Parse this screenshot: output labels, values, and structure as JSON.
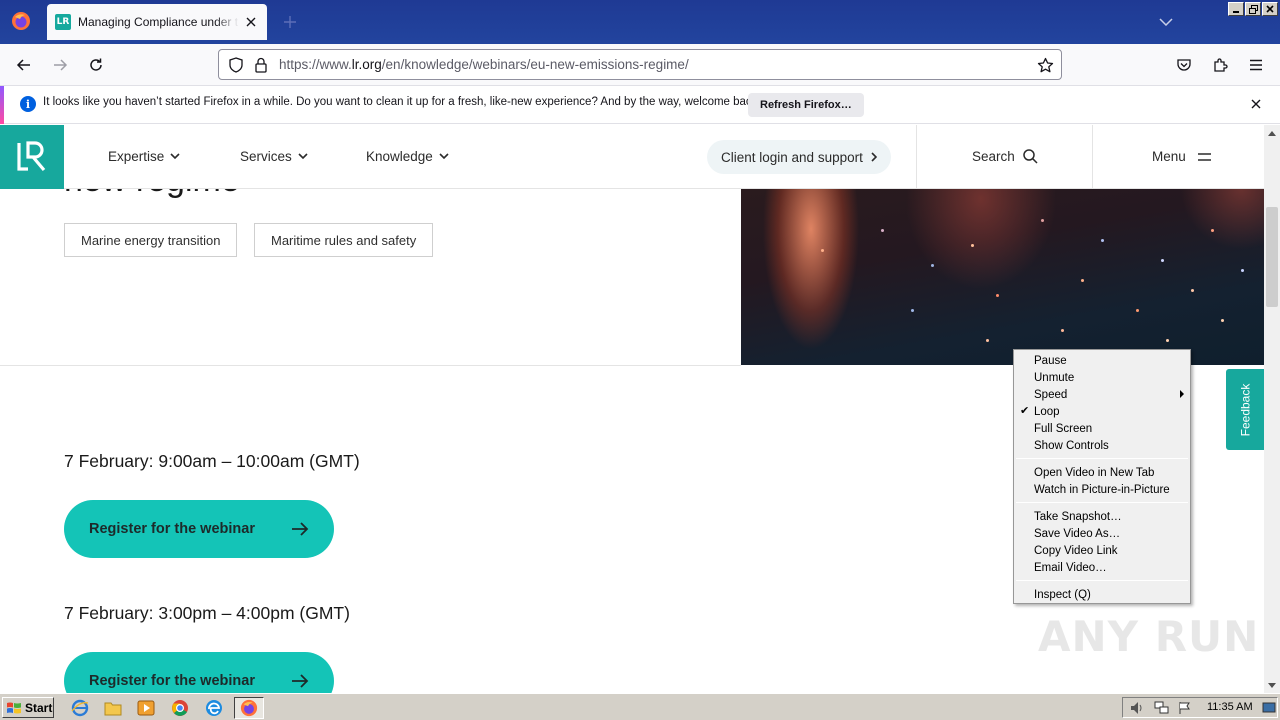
{
  "browser": {
    "tab_title": "Managing Compliance under the EU",
    "tab_favicon_text": "LR",
    "url_prefix": "https://www.",
    "url_domain": "lr.org",
    "url_path": "/en/knowledge/webinars/eu-new-emissions-regime/"
  },
  "notification": {
    "message": "It looks like you haven’t started Firefox in a while. Do you want to clean it up for a fresh, like-new experience? And by the way, welcome back!",
    "button_label": "Refresh Firefox…"
  },
  "site": {
    "nav": [
      {
        "label": "Expertise"
      },
      {
        "label": "Services"
      },
      {
        "label": "Knowledge"
      }
    ],
    "client_login": "Client login and support",
    "search_label": "Search",
    "menu_label": "Menu",
    "hero_title_partial": "new regime",
    "tags": [
      "Marine energy transition",
      "Maritime rules and safety"
    ],
    "sessions": [
      {
        "time": "7 February: 9:00am – 10:00am (GMT)",
        "button": "Register for the webinar"
      },
      {
        "time": "7 February: 3:00pm – 4:00pm (GMT)",
        "button": "Register for the webinar"
      }
    ],
    "feedback_label": "Feedback",
    "brand_color": "#17a89d",
    "button_color": "#14c4b7"
  },
  "context_menu": {
    "items": [
      {
        "label": "Pause",
        "checked": false,
        "submenu": false
      },
      {
        "label": "Unmute",
        "checked": false,
        "submenu": false
      },
      {
        "label": "Speed",
        "checked": false,
        "submenu": true
      },
      {
        "label": "Loop",
        "checked": true,
        "submenu": false
      },
      {
        "label": "Full Screen",
        "checked": false,
        "submenu": false
      },
      {
        "label": "Show Controls",
        "checked": false,
        "submenu": false
      },
      {
        "separator": true
      },
      {
        "label": "Open Video in New Tab",
        "checked": false,
        "submenu": false
      },
      {
        "label": "Watch in Picture-in-Picture",
        "checked": false,
        "submenu": false
      },
      {
        "separator": true
      },
      {
        "label": "Take Snapshot…",
        "checked": false,
        "submenu": false
      },
      {
        "label": "Save Video As…",
        "checked": false,
        "submenu": false
      },
      {
        "label": "Copy Video Link",
        "checked": false,
        "submenu": false
      },
      {
        "label": "Email Video…",
        "checked": false,
        "submenu": false
      },
      {
        "separator": true
      },
      {
        "label": "Inspect (Q)",
        "checked": false,
        "submenu": false
      }
    ]
  },
  "taskbar": {
    "start_label": "Start",
    "clock": "11:35 AM"
  },
  "watermark": "ANY RUN"
}
